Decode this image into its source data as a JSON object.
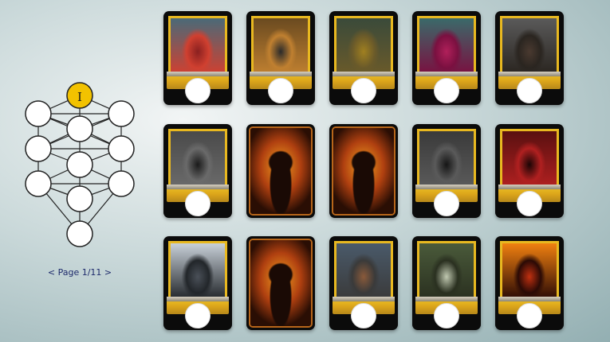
{
  "tree": {
    "top_node_label": "I",
    "colors": {
      "top_node_fill": "#f2c200",
      "node_fill": "#ffffff",
      "node_stroke": "#222222",
      "edge": "#222222"
    }
  },
  "pagination": {
    "prev_label": "<",
    "page_label": "Page 1/11",
    "next_label": ">"
  },
  "cards": [
    {
      "name": "red-hooded-woman",
      "style": "framed",
      "palette": [
        "#4a6a78",
        "#8a2020",
        "#d04030"
      ]
    },
    {
      "name": "jackal-warrior",
      "style": "framed",
      "palette": [
        "#6a4a20",
        "#2a2a2a",
        "#c08030"
      ]
    },
    {
      "name": "armored-beast",
      "style": "framed",
      "palette": [
        "#3a4a3a",
        "#a08020",
        "#6a5a2a"
      ]
    },
    {
      "name": "eye-tentacle-creature",
      "style": "framed",
      "palette": [
        "#3a6a6a",
        "#b0205a",
        "#7a1040"
      ]
    },
    {
      "name": "hulking-brute",
      "style": "framed",
      "palette": [
        "#5a5a5a",
        "#4a3a30",
        "#2a2520"
      ]
    },
    {
      "name": "dark-dragon",
      "style": "framed",
      "palette": [
        "#4a4a4a",
        "#1a1a1a",
        "#6a6a6a"
      ]
    },
    {
      "name": "hooded-figure-flames-1",
      "style": "full-art",
      "palette": [
        "#f0a020",
        "#b04010",
        "#1a0a05"
      ]
    },
    {
      "name": "hooded-figure-flames-2",
      "style": "full-art",
      "palette": [
        "#f0a020",
        "#b04010",
        "#1a0a05"
      ]
    },
    {
      "name": "shadow-figure",
      "style": "framed",
      "palette": [
        "#3a3a3a",
        "#151515",
        "#5a5a5a"
      ]
    },
    {
      "name": "crimson-demon",
      "style": "framed",
      "palette": [
        "#5a1010",
        "#1a0505",
        "#b02020"
      ]
    },
    {
      "name": "wolf-beast",
      "style": "framed",
      "palette": [
        "#c8d0d8",
        "#4a5058",
        "#22262a"
      ]
    },
    {
      "name": "hooded-figure-flames-3",
      "style": "full-art",
      "palette": [
        "#f0a020",
        "#b04010",
        "#1a0a05"
      ]
    },
    {
      "name": "dwarf-warrior",
      "style": "framed",
      "palette": [
        "#4a5a6a",
        "#8a5a3a",
        "#3a3a3a"
      ]
    },
    {
      "name": "elf-knight",
      "style": "framed",
      "palette": [
        "#4a5a3a",
        "#c0c8b0",
        "#2a3020"
      ]
    },
    {
      "name": "fire-elemental",
      "style": "framed",
      "palette": [
        "#f08010",
        "#c03010",
        "#2a0a05"
      ]
    }
  ]
}
